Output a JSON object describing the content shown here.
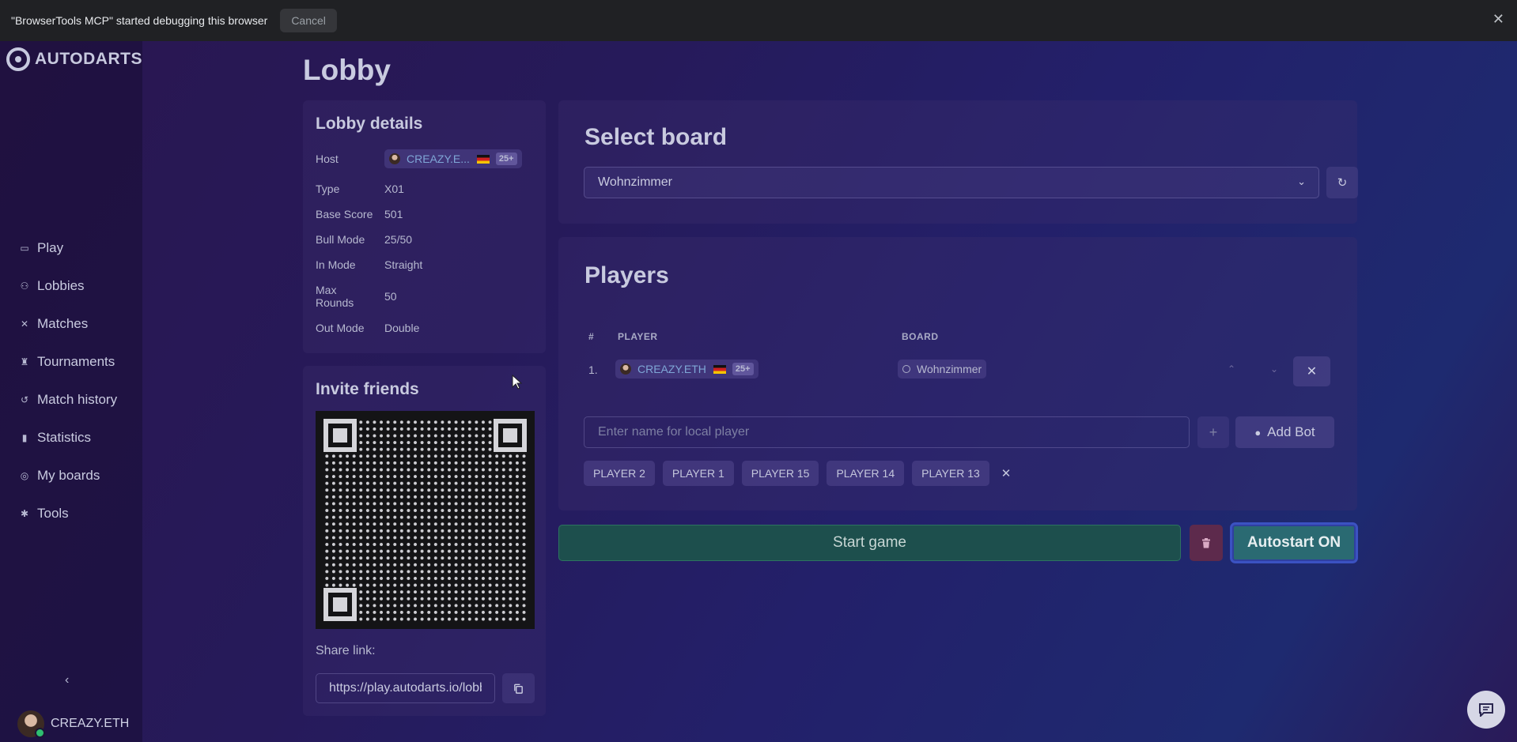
{
  "debug_bar": {
    "message": "\"BrowserTools MCP\" started debugging this browser",
    "cancel": "Cancel",
    "close_icon": "close-icon"
  },
  "brand": {
    "name": "AUTODARTS"
  },
  "nav": {
    "items": [
      {
        "label": "Play",
        "icon": "gamepad-icon"
      },
      {
        "label": "Lobbies",
        "icon": "users-icon"
      },
      {
        "label": "Matches",
        "icon": "crossed-swords-icon"
      },
      {
        "label": "Tournaments",
        "icon": "trophy-icon"
      },
      {
        "label": "Match history",
        "icon": "history-icon"
      },
      {
        "label": "Statistics",
        "icon": "bar-chart-icon"
      },
      {
        "label": "My boards",
        "icon": "target-icon"
      },
      {
        "label": "Tools",
        "icon": "puzzle-icon"
      }
    ],
    "collapse_icon": "chevron-left-icon"
  },
  "user": {
    "name": "CREAZY.ETH",
    "status": "online"
  },
  "page": {
    "title": "Lobby"
  },
  "lobby_details": {
    "title": "Lobby details",
    "host_label": "Host",
    "host": {
      "name": "CREAZY.E...",
      "badge": "25+"
    },
    "rows": [
      {
        "label": "Type",
        "value": "X01"
      },
      {
        "label": "Base Score",
        "value": "501"
      },
      {
        "label": "Bull Mode",
        "value": "25/50"
      },
      {
        "label": "In Mode",
        "value": "Straight"
      },
      {
        "label": "Max Rounds",
        "value": "50"
      },
      {
        "label": "Out Mode",
        "value": "Double"
      }
    ]
  },
  "invite": {
    "title": "Invite friends",
    "share_label": "Share link:",
    "share_link": "https://play.autodarts.io/lobbies"
  },
  "select_board": {
    "title": "Select board",
    "selected": "Wohnzimmer"
  },
  "players": {
    "title": "Players",
    "columns": {
      "num": "#",
      "player": "PLAYER",
      "board": "BOARD"
    },
    "rows": [
      {
        "num": "1.",
        "name": "CREAZY.ETH",
        "badge": "25+",
        "board": "Wohnzimmer"
      }
    ],
    "local_placeholder": "Enter name for local player",
    "add_bot": "Add Bot",
    "recent": [
      "PLAYER 2",
      "PLAYER 1",
      "PLAYER 15",
      "PLAYER 14",
      "PLAYER 13"
    ]
  },
  "actions": {
    "start": "Start game",
    "autostart": "Autostart ON"
  },
  "colors": {
    "start_bg": "#1d4f4d",
    "delete_bg": "#5d2a4c",
    "autostart_bg": "#2a6a72",
    "player_name": "#7fa6d6"
  }
}
